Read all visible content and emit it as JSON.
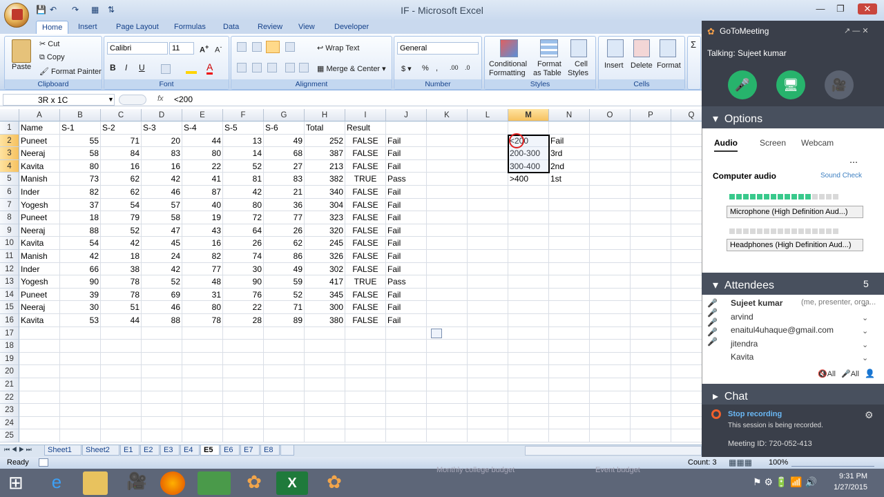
{
  "window": {
    "title": "IF - Microsoft Excel"
  },
  "ribbon_tabs": [
    "Home",
    "Insert",
    "Page Layout",
    "Formulas",
    "Data",
    "Review",
    "View",
    "Developer"
  ],
  "clipboard": {
    "paste": "Paste",
    "cut": "Cut",
    "copy": "Copy",
    "format_painter": "Format Painter",
    "label": "Clipboard"
  },
  "font": {
    "name": "Calibri",
    "size": "11",
    "label": "Font"
  },
  "alignment": {
    "wrap": "Wrap Text",
    "merge": "Merge & Center",
    "label": "Alignment"
  },
  "number": {
    "format": "General",
    "label": "Number"
  },
  "styles": {
    "conditional": "Conditional",
    "conditional2": "Formatting",
    "format_table": "Format",
    "format_table2": "as Table",
    "cell_styles": "Cell",
    "cell_styles2": "Styles",
    "label": "Styles"
  },
  "cells": {
    "insert": "Insert",
    "delete": "Delete",
    "format": "Format",
    "label": "Cells"
  },
  "namebox": "3R x 1C",
  "fx": "fx",
  "formula": "<200",
  "columns": [
    "A",
    "B",
    "C",
    "D",
    "E",
    "F",
    "G",
    "H",
    "I",
    "J",
    "K",
    "L",
    "M",
    "N",
    "O",
    "P",
    "Q"
  ],
  "headers": [
    "Name",
    "S-1",
    "S-2",
    "S-3",
    "S-4",
    "S-5",
    "S-6",
    "Total",
    "Result"
  ],
  "rows": [
    [
      "Puneet",
      "55",
      "71",
      "20",
      "44",
      "13",
      "49",
      "252",
      "FALSE",
      "Fail",
      "<200",
      "Fail"
    ],
    [
      "Neeraj",
      "58",
      "84",
      "83",
      "80",
      "14",
      "68",
      "387",
      "FALSE",
      "Fail",
      "200-300",
      "3rd"
    ],
    [
      "Kavita",
      "80",
      "16",
      "16",
      "22",
      "52",
      "27",
      "213",
      "FALSE",
      "Fail",
      "300-400",
      "2nd"
    ],
    [
      "Manish",
      "73",
      "62",
      "42",
      "41",
      "81",
      "83",
      "382",
      "TRUE",
      "Pass",
      ">400",
      "1st"
    ],
    [
      "Inder",
      "82",
      "62",
      "46",
      "87",
      "42",
      "21",
      "340",
      "FALSE",
      "Fail",
      "",
      ""
    ],
    [
      "Yogesh",
      "37",
      "54",
      "57",
      "40",
      "80",
      "36",
      "304",
      "FALSE",
      "Fail",
      "",
      ""
    ],
    [
      "Puneet",
      "18",
      "79",
      "58",
      "19",
      "72",
      "77",
      "323",
      "FALSE",
      "Fail",
      "",
      ""
    ],
    [
      "Neeraj",
      "88",
      "52",
      "47",
      "43",
      "64",
      "26",
      "320",
      "FALSE",
      "Fail",
      "",
      ""
    ],
    [
      "Kavita",
      "54",
      "42",
      "45",
      "16",
      "26",
      "62",
      "245",
      "FALSE",
      "Fail",
      "",
      ""
    ],
    [
      "Manish",
      "42",
      "18",
      "24",
      "82",
      "74",
      "86",
      "326",
      "FALSE",
      "Fail",
      "",
      ""
    ],
    [
      "Inder",
      "66",
      "38",
      "42",
      "77",
      "30",
      "49",
      "302",
      "FALSE",
      "Fail",
      "",
      ""
    ],
    [
      "Yogesh",
      "90",
      "78",
      "52",
      "48",
      "90",
      "59",
      "417",
      "TRUE",
      "Pass",
      "",
      ""
    ],
    [
      "Puneet",
      "39",
      "78",
      "69",
      "31",
      "76",
      "52",
      "345",
      "FALSE",
      "Fail",
      "",
      ""
    ],
    [
      "Neeraj",
      "30",
      "51",
      "46",
      "80",
      "22",
      "71",
      "300",
      "FALSE",
      "Fail",
      "",
      ""
    ],
    [
      "Kavita",
      "53",
      "44",
      "88",
      "78",
      "28",
      "89",
      "380",
      "FALSE",
      "Fail",
      "",
      ""
    ]
  ],
  "row_numbers": [
    "1",
    "2",
    "3",
    "4",
    "5",
    "6",
    "7",
    "8",
    "9",
    "10",
    "11",
    "12",
    "13",
    "14",
    "15",
    "16",
    "17",
    "18",
    "19",
    "20",
    "21",
    "22",
    "23",
    "24",
    "25"
  ],
  "sheets": [
    "Sheet1",
    "Sheet2",
    "E1",
    "E2",
    "E3",
    "E4",
    "E5",
    "E6",
    "E7",
    "E8"
  ],
  "active_sheet": "E5",
  "status": {
    "ready": "Ready",
    "count": "Count: 3",
    "zoom": "100%"
  },
  "taskbar": {
    "time": "9:31 PM",
    "date": "1/27/2015",
    "ghost1": "Monthly college budget",
    "ghost2": "Event budget"
  },
  "gtm": {
    "title": "GoToMeeting",
    "talking": "Talking: Sujeet kumar",
    "options": "Options",
    "audio_tabs": [
      "Audio",
      "Screen",
      "Webcam"
    ],
    "computer_audio": "Computer audio",
    "sound_check": "Sound Check",
    "mic": "Microphone (High Definition Aud...)",
    "headphones": "Headphones (High Definition Aud...)",
    "attendees_label": "Attendees",
    "attendees_count": "5",
    "attendees": [
      "Sujeet kumar",
      "arvind",
      "enaitul4uhaque@gmail.com",
      "jitendra",
      "Kavita"
    ],
    "presenter_note": "(me, presenter, orga...",
    "mute_all": "All",
    "unmute_all": "All",
    "chat": "Chat",
    "stop_recording": "Stop recording",
    "recorded": "This session is being recorded.",
    "meeting_id": "Meeting ID: 720-052-413"
  }
}
